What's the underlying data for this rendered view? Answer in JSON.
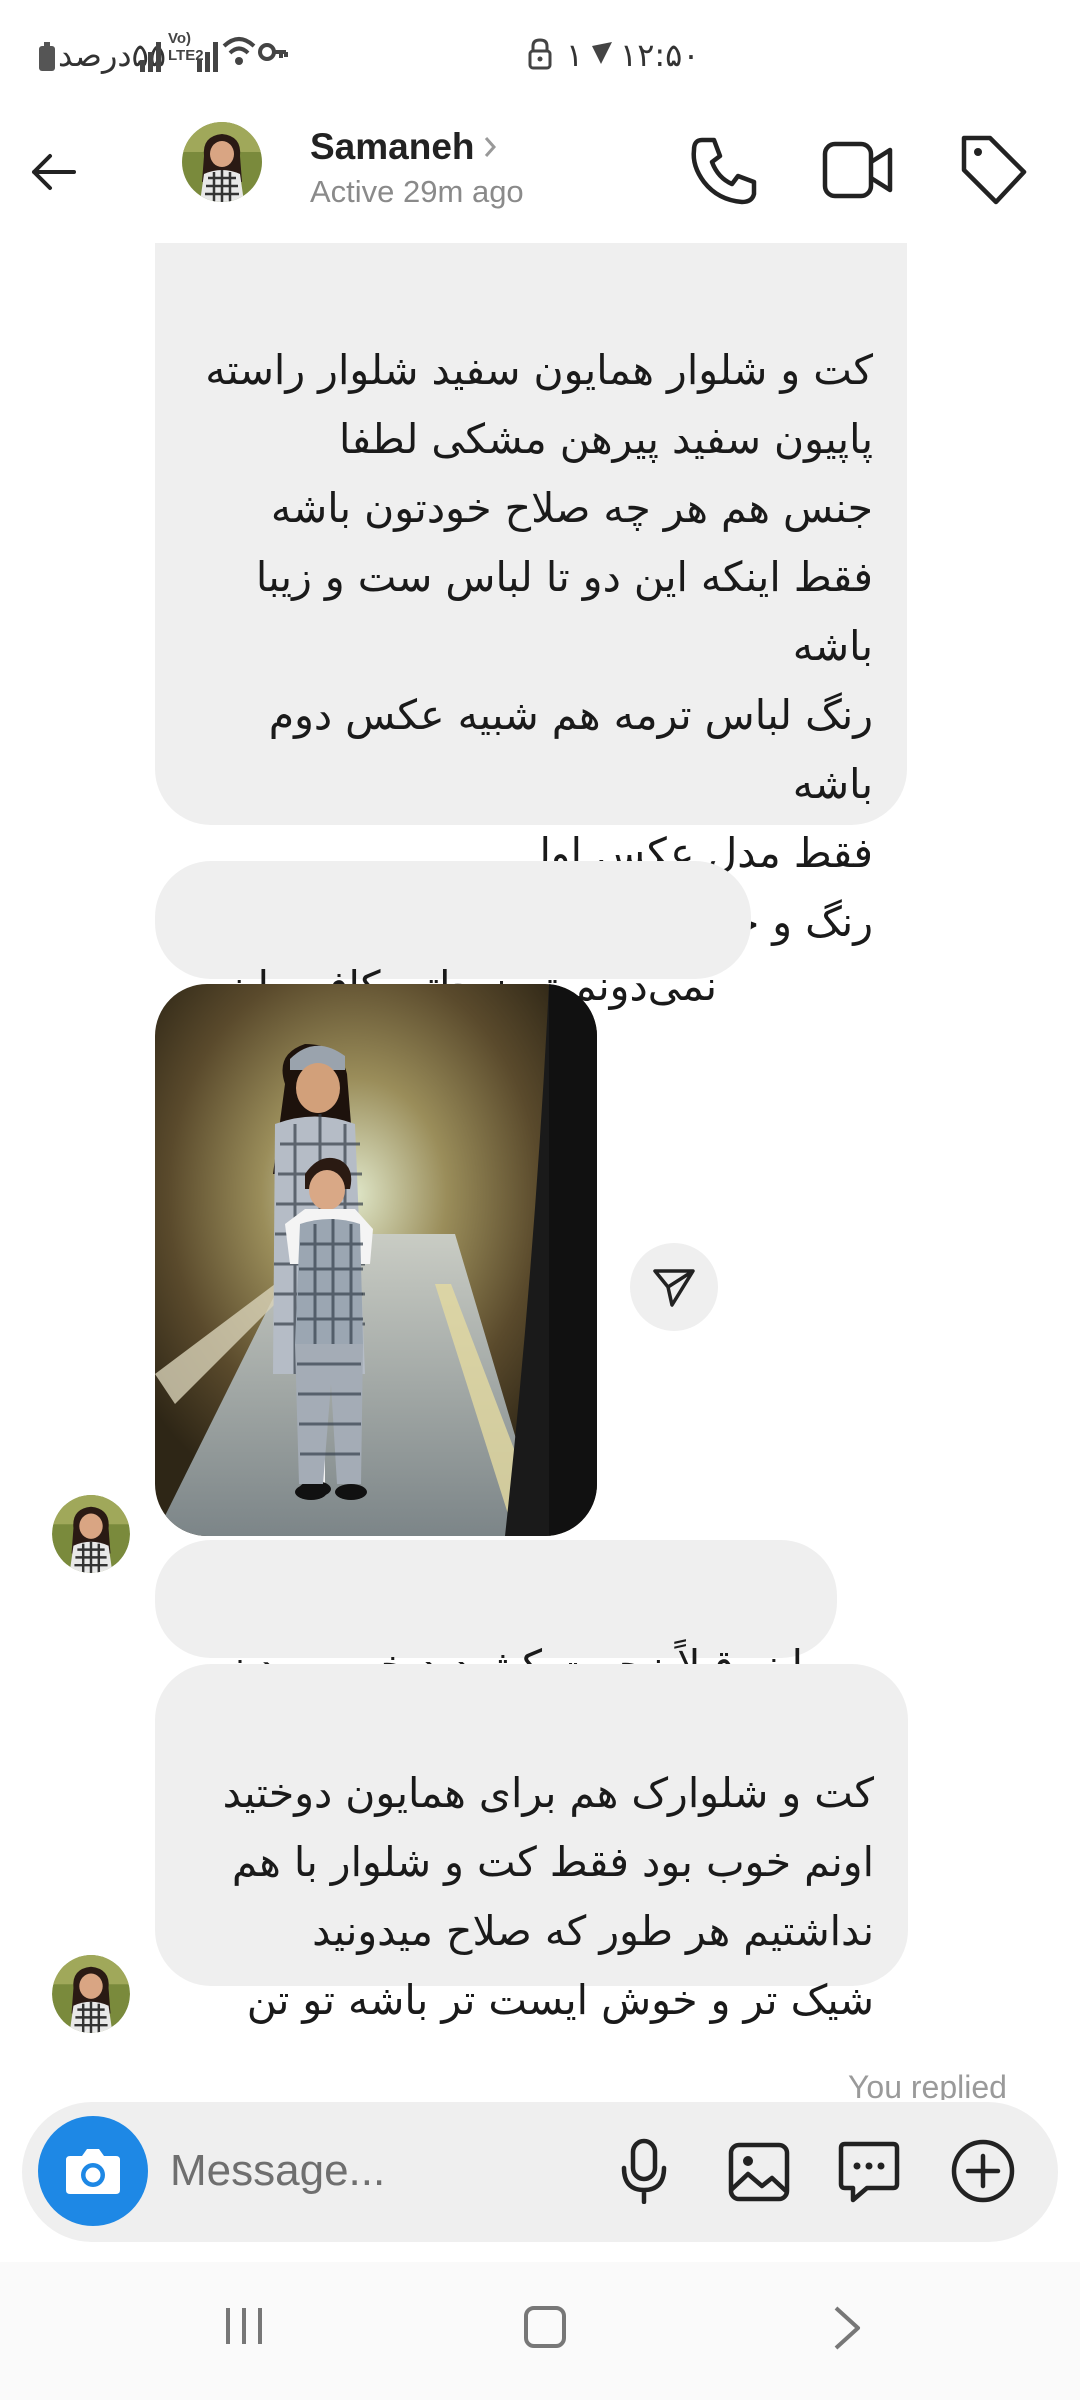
{
  "status_bar": {
    "time": "۱۲:۵۰",
    "notification_count": "۱",
    "battery_text": "۵۵درصد",
    "lte_label": "Vo) LTE2"
  },
  "header": {
    "contact_name": "Samaneh",
    "activity": "Active 29m ago"
  },
  "messages": {
    "m1": "کت و شلوار همایون سفید شلوار راسته\nپاپیون سفید پیرهن مشکی لطفا\nجنس هم هر چه صلاح خودتون باشه\nفقط اینکه این دو تا لباس ست و زیبا\nباشه\nرنگ لباس ترمه هم شبیه عکس دوم باشه\nفقط مدل عکس اول\nرنگ و جنس پارچه دومی مدل اولی",
    "m2": "نمی‌دونم توضیحاتی کافیه یا نه",
    "m3": "اینو قبلاً زحمت کشیدید خوب بودن",
    "m4": "کت و شلوارک هم برای همایون دوختید\nاونم خوب بود فقط کت و شلوار با هم\nنداشتیم هر طور که صلاح میدونید\nشیک تر و خوش ایست تر باشه تو تن",
    "reply_note": "You replied"
  },
  "composer": {
    "placeholder": "Message..."
  },
  "colors": {
    "camera_blue": "#1e88e5",
    "bubble_gray": "#efefef",
    "secondary_text": "#8a8a8a"
  }
}
